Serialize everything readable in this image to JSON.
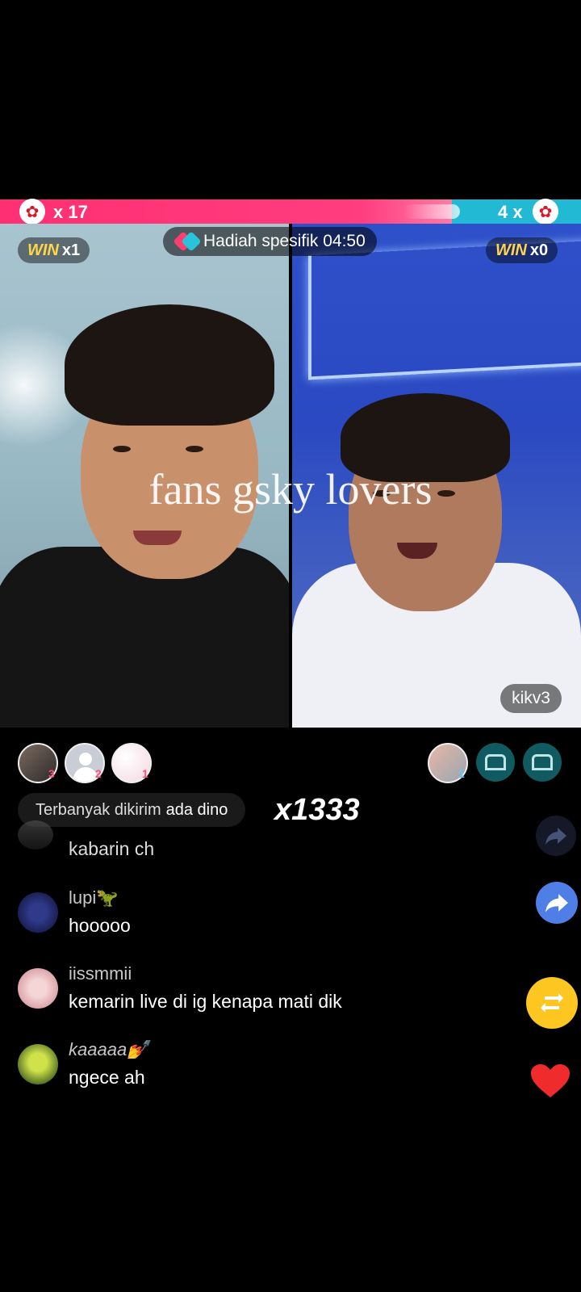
{
  "battle": {
    "left_score": "x 17",
    "right_score": "4 x",
    "left_icon": "rose-icon",
    "right_icon": "rose-icon",
    "left_color": "#ff2f73",
    "right_color": "#21b9d3"
  },
  "left_streamer": {
    "win_label": "WIN",
    "win_count": "x1"
  },
  "right_streamer": {
    "win_label": "WIN",
    "win_count": "x0",
    "name": "kikv3"
  },
  "gift_challenge": {
    "label": "Hadiah spesifik 04:50"
  },
  "watermark": "fans gsky lovers",
  "supporters_left": [
    {
      "rank": "3"
    },
    {
      "rank": "2"
    },
    {
      "rank": "1"
    }
  ],
  "supporters_right": [
    {
      "rank": "1"
    }
  ],
  "top_sender": {
    "prefix": "Terbanyak dikirim",
    "name": "ada dino",
    "count": "x1333"
  },
  "chat": [
    {
      "user": "",
      "message": "kabarin ch"
    },
    {
      "user": "lupi🦖",
      "message": "hooooo"
    },
    {
      "user": "iissmmii",
      "message": "kemarin live di ig kenapa mati dik"
    },
    {
      "user": "kaaaaa💅",
      "message": "ngece ah"
    }
  ],
  "actions": {
    "share_icon": "share-icon",
    "repost_icon": "repost-icon",
    "like_icon": "heart-icon"
  }
}
